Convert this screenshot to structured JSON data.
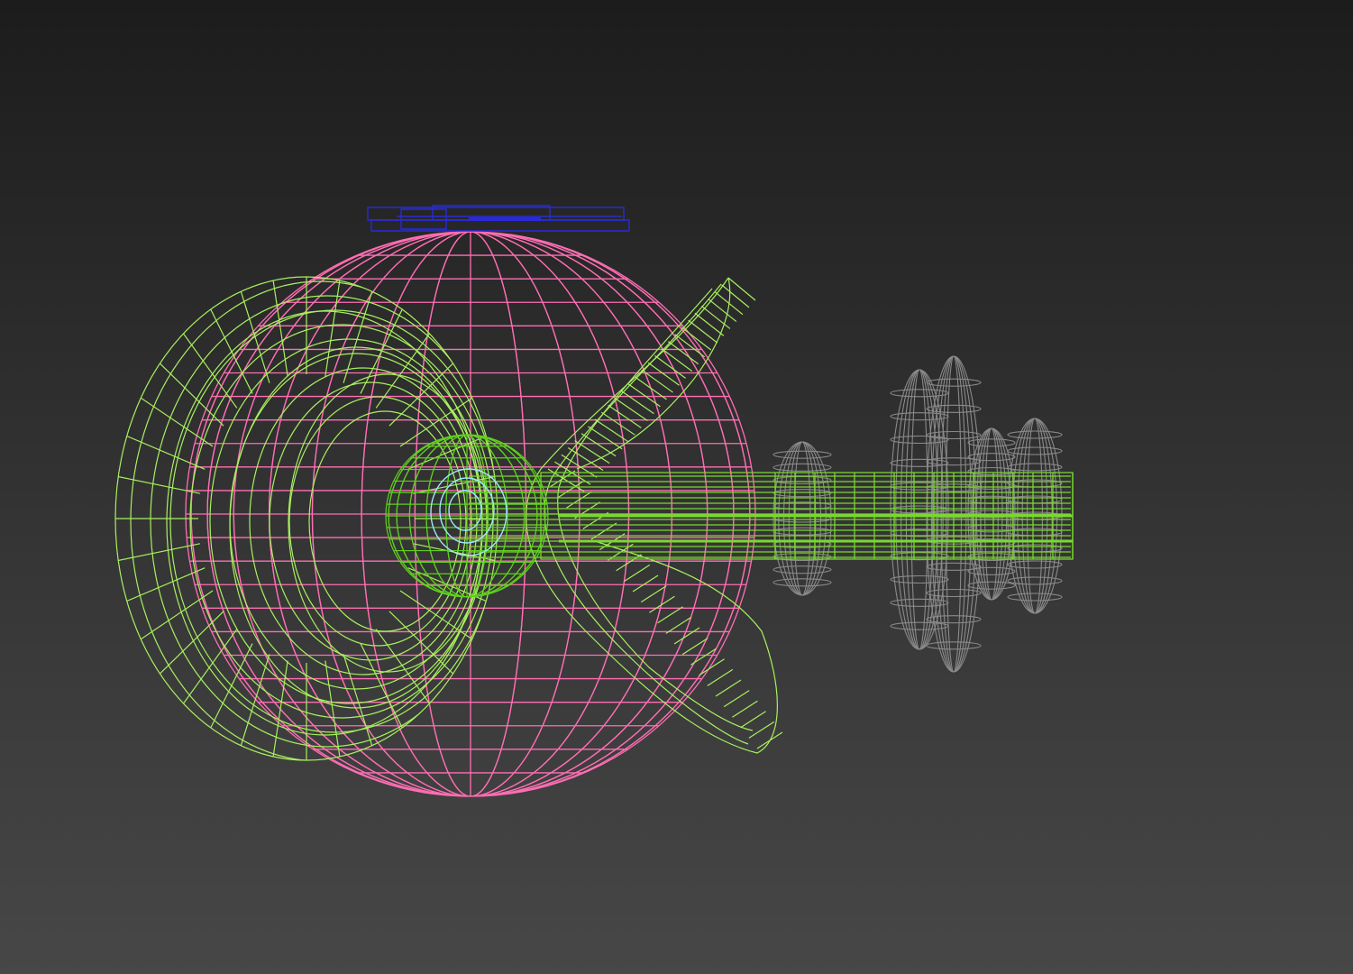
{
  "viewport": {
    "background_top": "#1c1c1c",
    "background_bottom": "#474747",
    "render_mode": "wireframe"
  },
  "objects": [
    {
      "name": "guitar-body-shell",
      "kind": "mesh",
      "wire_color": "#ff6eb4"
    },
    {
      "name": "guitar-body-torus",
      "kind": "mesh",
      "wire_color": "#a8f060"
    },
    {
      "name": "twisted-ribbon",
      "kind": "mesh",
      "wire_color": "#a8f060"
    },
    {
      "name": "sound-hole-sphere",
      "kind": "mesh",
      "wire_color": "#5fd01e"
    },
    {
      "name": "sound-hole-inner",
      "kind": "mesh",
      "wire_color": "#9ee8ff"
    },
    {
      "name": "guitar-neck",
      "kind": "mesh",
      "wire_color": "#7ad830"
    },
    {
      "name": "tuning-pegs",
      "kind": "mesh",
      "wire_color": "#8a8a8a"
    },
    {
      "name": "bridge-plate",
      "kind": "mesh",
      "wire_color": "#2a2ad8"
    }
  ]
}
